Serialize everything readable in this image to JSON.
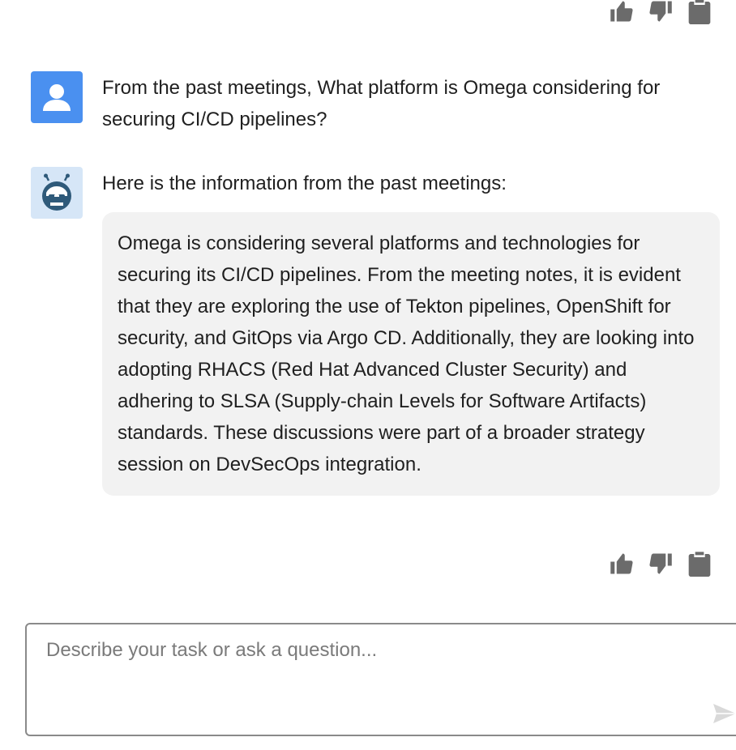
{
  "conversation": {
    "user_message": {
      "text": "From the past meetings, What platform is Omega considering for securing CI/CD pipelines?"
    },
    "bot_message": {
      "intro": "Here is the information from the past meetings:",
      "answer": "Omega is considering several platforms and technologies for securing its CI/CD pipelines. From the meeting notes, it is evident that they are exploring the use of Tekton pipelines, OpenShift for security, and GitOps via Argo CD. Additionally, they are looking into adopting RHACS (Red Hat Advanced Cluster Security) and adhering to SLSA (Supply-chain Levels for Software Artifacts) standards. These discussions were part of a broader strategy session on DevSecOps integration."
    }
  },
  "message_actions": {
    "icons": [
      "thumbs-up-icon",
      "thumbs-down-icon",
      "clipboard-icon"
    ]
  },
  "composer": {
    "placeholder": "Describe your task or ask a question...",
    "value": "",
    "send_icon": "send-icon"
  },
  "colors": {
    "user_avatar": "#4a90f0",
    "bot_avatar_bg": "#d6e6f7",
    "bot_avatar_face": "#2f5a7a",
    "bot_card_bg": "#f2f2f2",
    "icon_gray": "#6b6b6b"
  }
}
